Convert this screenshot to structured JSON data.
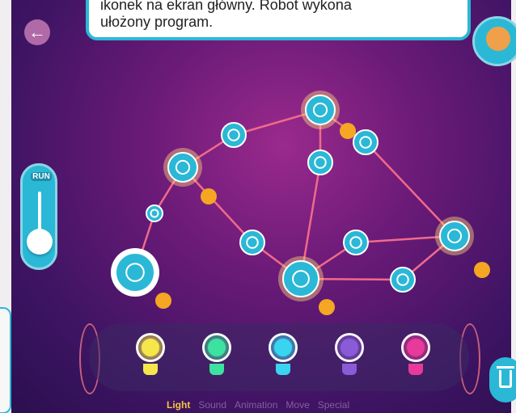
{
  "instruction": {
    "line1": "ikonek na ekran główny. Robot wykona",
    "line2": "ułożony program."
  },
  "back_button": {
    "icon": "arrow-left-icon"
  },
  "run_panel": {
    "label": "RUN"
  },
  "palette": {
    "bulbs": [
      {
        "color": "#f5e64a"
      },
      {
        "color": "#3de2a0"
      },
      {
        "color": "#39d4f0"
      },
      {
        "color": "#8a5bd6"
      },
      {
        "color": "#e83a9a"
      }
    ],
    "tabs": [
      "Light",
      "Sound",
      "Animation",
      "Move",
      "Special"
    ],
    "active_tab": "Light"
  },
  "colors": {
    "accent": "#2ab8d6",
    "line": "#f06a8a",
    "timer": "#f5a623",
    "node": "#2ab8d6"
  }
}
